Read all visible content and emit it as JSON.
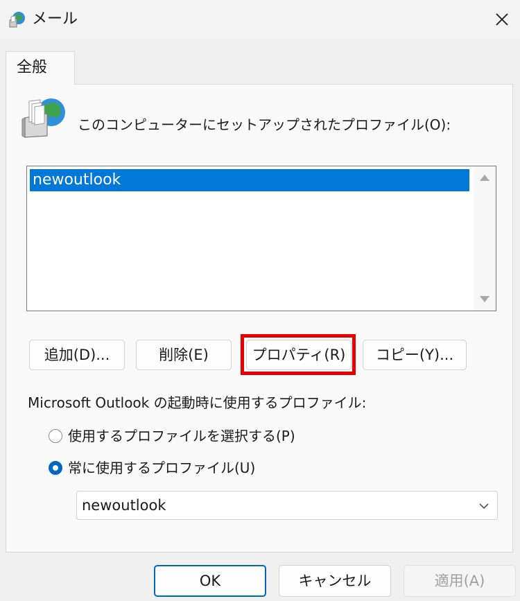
{
  "window": {
    "title": "メール",
    "icon": "mail-profile-icon",
    "close_icon": "close-icon"
  },
  "tabs": [
    {
      "label": "全般",
      "selected": true
    }
  ],
  "profiles": {
    "label": "このコンピューターにセットアップされたプロファイル(O):",
    "items": [
      {
        "name": "newoutlook",
        "selected": true
      }
    ]
  },
  "actions": {
    "add": "追加(D)...",
    "delete": "削除(E)",
    "properties": "プロパティ(R)",
    "copy": "コピー(Y)..."
  },
  "startup": {
    "label": "Microsoft Outlook の起動時に使用するプロファイル:",
    "options": [
      {
        "label": "使用するプロファイルを選択する(P)",
        "selected": false
      },
      {
        "label": "常に使用するプロファイル(U)",
        "selected": true
      }
    ],
    "selected_profile": "newoutlook"
  },
  "footer": {
    "ok": "OK",
    "cancel": "キャンセル",
    "apply": "適用(A)",
    "apply_enabled": false
  },
  "colors": {
    "selection": "#0078d7",
    "highlight_box": "#e60000",
    "accent": "#0067c0"
  }
}
